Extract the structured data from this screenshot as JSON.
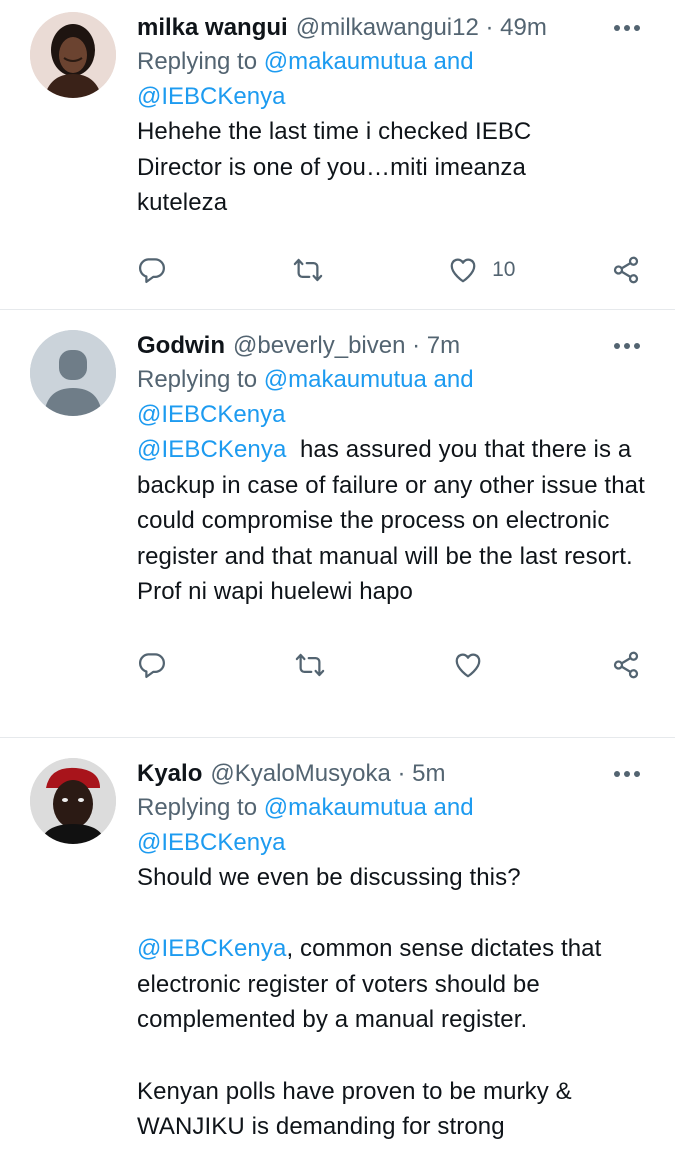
{
  "tweets": [
    {
      "name": "milka wangui",
      "handle": "@milkawangui12",
      "time": "49m",
      "replying_prefix": "Replying to",
      "reply_to_1": "@makaumutua",
      "reply_and": "and",
      "reply_to_2": "@IEBCKenya",
      "text": "Hehehe the last time i checked IEBC Director is one of you…miti imeanza kuteleza",
      "like_count": "10"
    },
    {
      "name": "Godwin",
      "handle": "@beverly_biven",
      "time": "7m",
      "replying_prefix": "Replying to",
      "reply_to_1": "@makaumutua",
      "reply_and": "and",
      "reply_to_2": "@IEBCKenya",
      "text_mention": "@IEBCKenya",
      "text": "has assured you that there is a backup in case of failure or any other issue that could compromise the process on electronic register and that manual will be the last resort. Prof ni wapi huelewi hapo",
      "like_count": ""
    },
    {
      "name": "Kyalo",
      "handle": "@KyaloMusyoka",
      "time": "5m",
      "replying_prefix": "Replying to",
      "reply_to_1": "@makaumutua",
      "reply_and": "and",
      "reply_to_2": "@IEBCKenya",
      "text_p1": "Should we even be discussing this?",
      "text_mention": "@IEBCKenya",
      "text_p2": ", common sense dictates that electronic register of voters should be complemented by a manual register.",
      "text_p3": "Kenyan polls have proven to be murky & WANJIKU is demanding for strong"
    }
  ],
  "separator": "·",
  "colors": {
    "accent": "#1d9bf0",
    "secondary_text": "#536471",
    "primary_text": "#0f1419",
    "border": "#e6e9ec"
  },
  "icons": [
    "reply-icon",
    "retweet-icon",
    "like-icon",
    "share-icon",
    "more-icon"
  ]
}
